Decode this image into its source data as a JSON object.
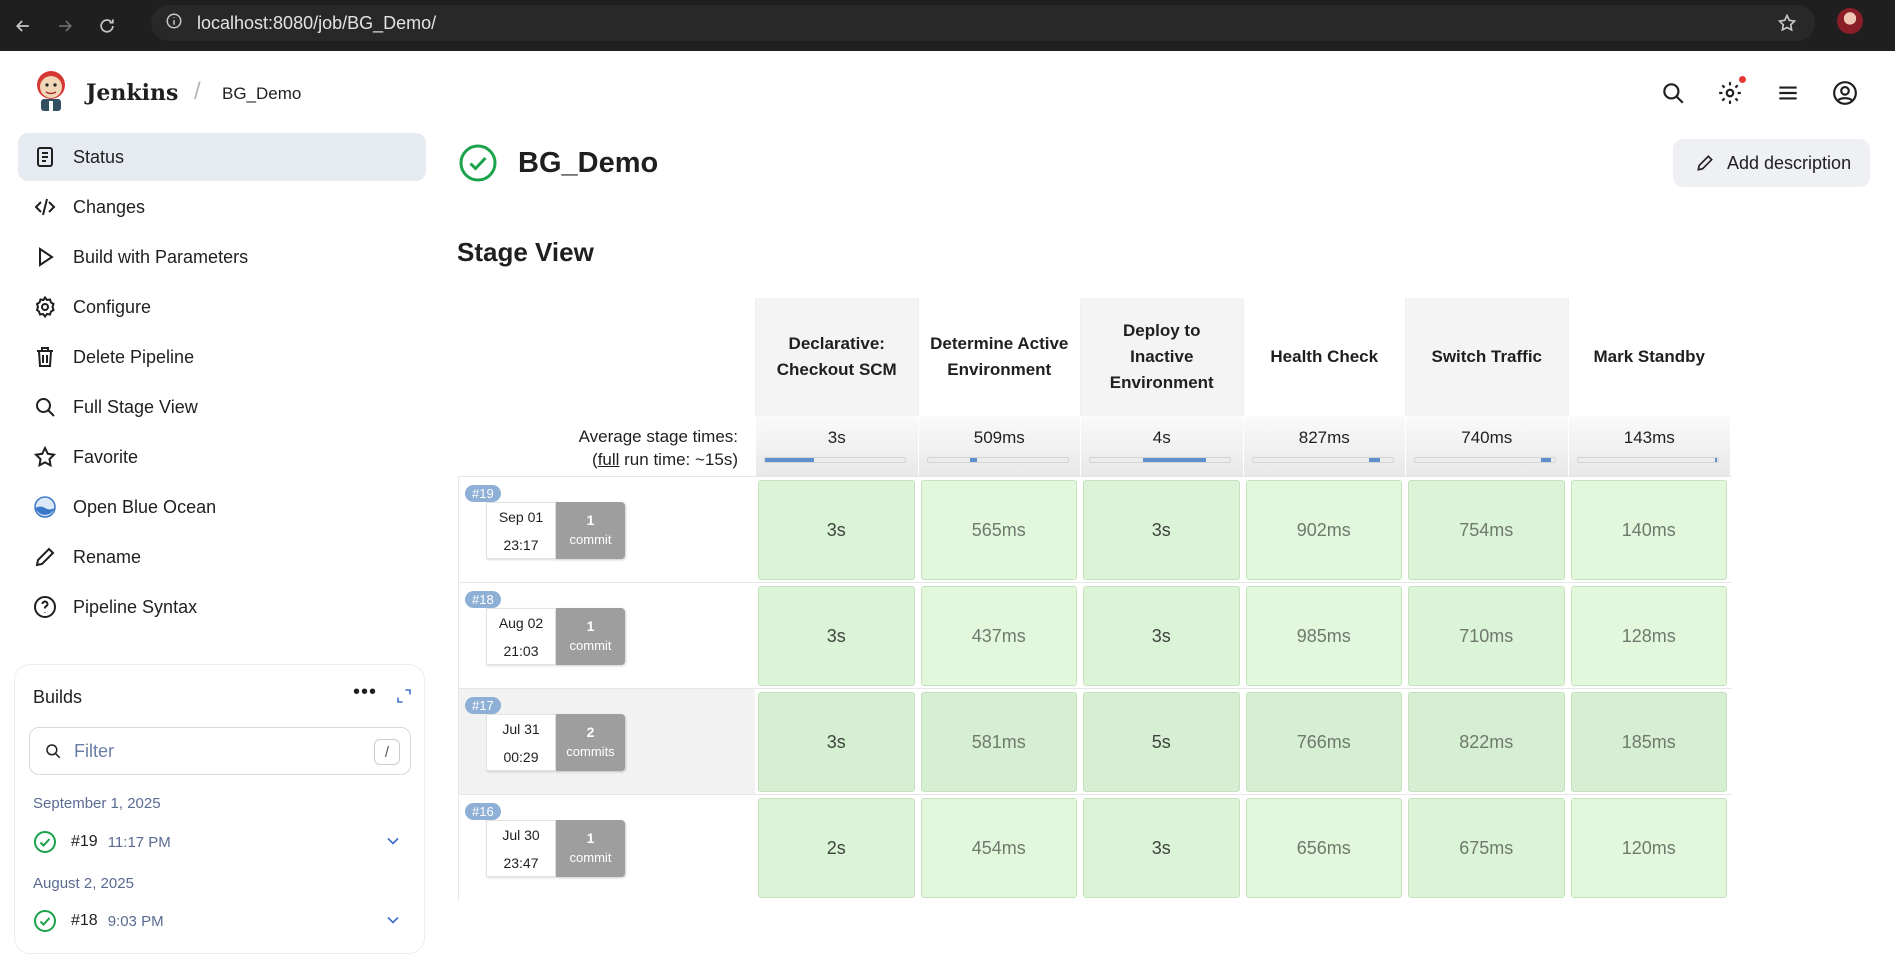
{
  "browser": {
    "url": "localhost:8080/job/BG_Demo/"
  },
  "header": {
    "brand": "Jenkins",
    "breadcrumb": "BG_Demo"
  },
  "sidebar": {
    "items": [
      {
        "label": "Status",
        "icon": "status-icon"
      },
      {
        "label": "Changes",
        "icon": "code-icon"
      },
      {
        "label": "Build with Parameters",
        "icon": "play-icon"
      },
      {
        "label": "Configure",
        "icon": "gear-icon"
      },
      {
        "label": "Delete Pipeline",
        "icon": "trash-icon"
      },
      {
        "label": "Full Stage View",
        "icon": "search-icon"
      },
      {
        "label": "Favorite",
        "icon": "star-icon"
      },
      {
        "label": "Open Blue Ocean",
        "icon": "blue-ocean-icon"
      },
      {
        "label": "Rename",
        "icon": "pencil-icon"
      },
      {
        "label": "Pipeline Syntax",
        "icon": "help-icon"
      }
    ]
  },
  "builds": {
    "title": "Builds",
    "filter_placeholder": "Filter",
    "filter_shortcut": "/",
    "groups": [
      {
        "date": "September 1, 2025",
        "number": "#19",
        "time": "11:17 PM"
      },
      {
        "date": "August 2, 2025",
        "number": "#18",
        "time": "9:03 PM"
      }
    ]
  },
  "main": {
    "title": "BG_Demo",
    "add_description": "Add description",
    "stage_view_title": "Stage View"
  },
  "stage_view": {
    "stages": [
      "Declarative: Checkout SCM",
      "Determine Active Environment",
      "Deploy to Inactive Environment",
      "Health Check",
      "Switch Traffic",
      "Mark Standby"
    ],
    "average_label_1": "Average stage times:",
    "average_label_full": "full",
    "average_label_2": " run time: ~15s)",
    "average_label_open": "(",
    "averages": [
      "3s",
      "509ms",
      "4s",
      "827ms",
      "740ms",
      "143ms"
    ],
    "average_fill": [
      0.35,
      0.05,
      0.45,
      0.08,
      0.07,
      0.02
    ],
    "runs": [
      {
        "badge": "#19",
        "date": "Sep 01",
        "time": "23:17",
        "commit_count": "1",
        "commit_label": "commit",
        "durations": [
          "3s",
          "565ms",
          "3s",
          "902ms",
          "754ms",
          "140ms"
        ]
      },
      {
        "badge": "#18",
        "date": "Aug 02",
        "time": "21:03",
        "commit_count": "1",
        "commit_label": "commit",
        "durations": [
          "3s",
          "437ms",
          "3s",
          "985ms",
          "710ms",
          "128ms"
        ]
      },
      {
        "badge": "#17",
        "date": "Jul 31",
        "time": "00:29",
        "commit_count": "2",
        "commit_label": "commits",
        "durations": [
          "3s",
          "581ms",
          "5s",
          "766ms",
          "822ms",
          "185ms"
        ]
      },
      {
        "badge": "#16",
        "date": "Jul 30",
        "time": "23:47",
        "commit_count": "1",
        "commit_label": "commit",
        "durations": [
          "2s",
          "454ms",
          "3s",
          "656ms",
          "675ms",
          "120ms"
        ]
      }
    ]
  },
  "colors": {
    "success": "#1aa34a",
    "stage_cell": "#e1f8dc",
    "badge": "#8fb0d6",
    "link": "#3d6ccf"
  }
}
